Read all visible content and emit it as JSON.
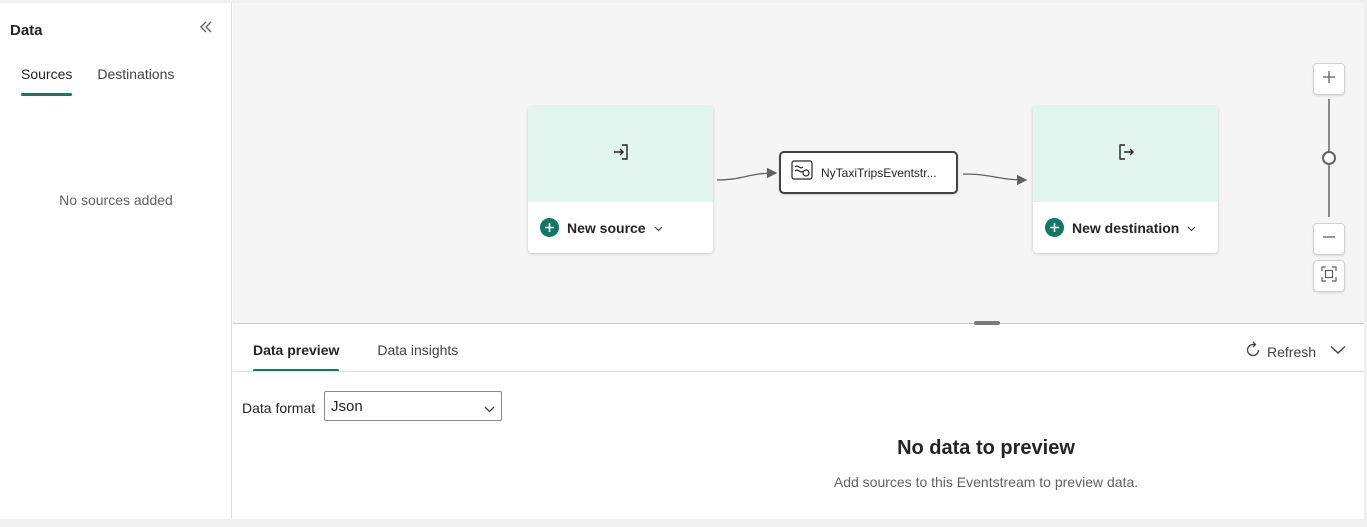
{
  "left_panel": {
    "title": "Data",
    "tabs": [
      {
        "label": "Sources",
        "active": true
      },
      {
        "label": "Destinations",
        "active": false
      }
    ],
    "empty_message": "No sources added"
  },
  "canvas": {
    "source_node": {
      "action_label": "New source",
      "icon": "sign-in-icon"
    },
    "eventstream_node": {
      "label": "NyTaxiTripsEventstr...",
      "icon": "eventstream-icon"
    },
    "destination_node": {
      "action_label": "New destination",
      "icon": "sign-out-icon"
    },
    "zoom": {
      "level_fraction": 0.5
    }
  },
  "bottom_panel": {
    "tabs": [
      {
        "label": "Data preview",
        "active": true
      },
      {
        "label": "Data insights",
        "active": false
      }
    ],
    "refresh_label": "Refresh",
    "data_format_label": "Data format",
    "data_format_value": "Json",
    "empty_title": "No data to preview",
    "empty_subtitle": "Add sources to this Eventstream to preview data."
  },
  "colors": {
    "accent": "#117865",
    "node_header": "#e2f6ef",
    "canvas_bg": "#f5f5f5"
  }
}
